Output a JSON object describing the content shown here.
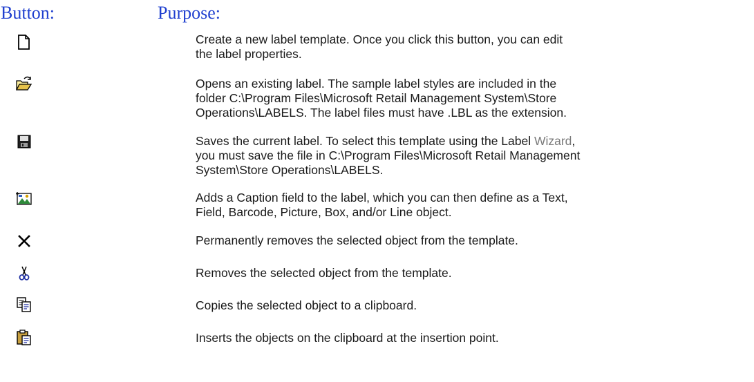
{
  "header": {
    "button_label": "Button:",
    "purpose_label": "Purpose:"
  },
  "rows": [
    {
      "icon": "new-document-icon",
      "text": "Create a new label template. Once you click this button, you can edit the label properties."
    },
    {
      "icon": "open-folder-icon",
      "text": "Opens an existing label. The sample label styles are included in the folder C:\\Program Files\\Microsoft Retail Management System\\Store Operations\\LABELS. The label files must have .LBL as the extension."
    },
    {
      "icon": "save-disk-icon",
      "text_before": "Saves the current label. To select this template using the Label ",
      "text_wizard": "Wizard",
      "text_after": ", you must save the file in C:\\Program Files\\Microsoft Retail Management System\\Store Operations\\LABELS."
    },
    {
      "icon": "add-caption-icon",
      "text": "Adds a Caption field to the label, which you can then define as a Text, Field, Barcode, Picture, Box, and/or Line object."
    },
    {
      "icon": "delete-x-icon",
      "text": "Permanently removes the selected object from the template."
    },
    {
      "icon": "cut-scissors-icon",
      "text": "Removes the selected object from the template."
    },
    {
      "icon": "copy-icon",
      "text": "Copies the selected object to a clipboard."
    },
    {
      "icon": "paste-clipboard-icon",
      "text": "Inserts the objects on the clipboard at the insertion point."
    }
  ]
}
